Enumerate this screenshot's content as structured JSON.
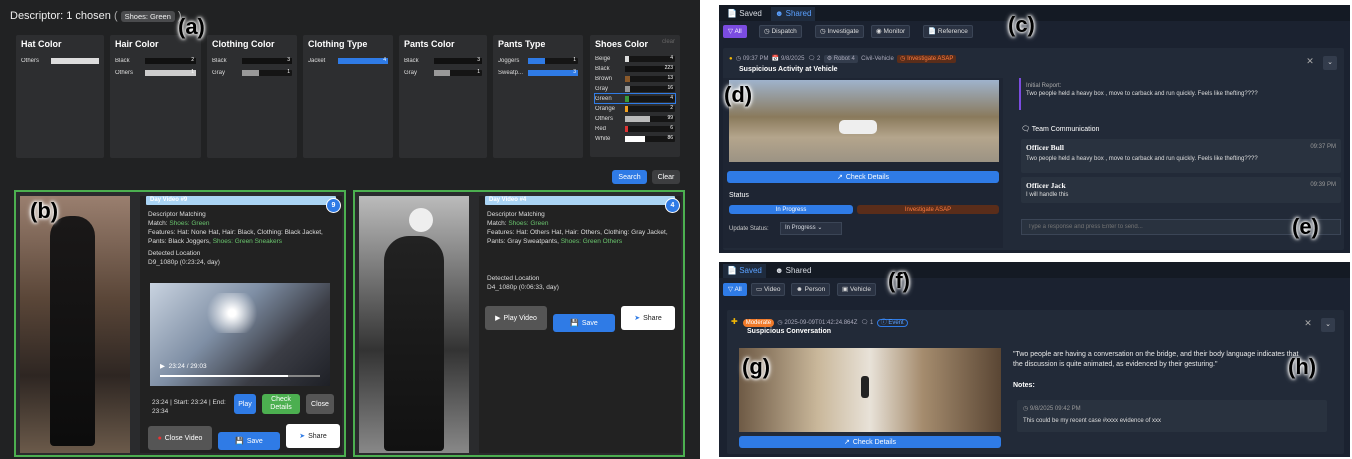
{
  "labels": {
    "a": "(a)",
    "b": "(b)",
    "c": "(c)",
    "d": "(d)",
    "e": "(e)",
    "f": "(f)",
    "g": "(g)",
    "h": "(h)"
  },
  "search": {
    "descriptor": "Descriptor: 1 chosen",
    "chip": "Shoes: Green",
    "search": "Search",
    "clear": "Clear"
  },
  "facets": [
    {
      "title": "Hat Color",
      "rows": [
        {
          "l": "Others",
          "n": "",
          "w": 100,
          "c": "#ddd"
        }
      ]
    },
    {
      "title": "Hair Color",
      "rows": [
        {
          "l": "Black",
          "n": "2",
          "w": 100,
          "c": "#111"
        },
        {
          "l": "Others",
          "n": "1",
          "w": 100,
          "c": "#ccc"
        }
      ]
    },
    {
      "title": "Clothing Color",
      "rows": [
        {
          "l": "Black",
          "n": "3",
          "w": 100,
          "c": "#111"
        },
        {
          "l": "Gray",
          "n": "1",
          "w": 33,
          "c": "#999"
        }
      ]
    },
    {
      "title": "Clothing Type",
      "rows": [
        {
          "l": "Jacket",
          "n": "4",
          "w": 100,
          "c": "#2f7be6"
        }
      ]
    },
    {
      "title": "Pants Color",
      "rows": [
        {
          "l": "Black",
          "n": "3",
          "w": 100,
          "c": "#111"
        },
        {
          "l": "Gray",
          "n": "1",
          "w": 33,
          "c": "#999"
        }
      ]
    },
    {
      "title": "Pants Type",
      "rows": [
        {
          "l": "Joggers",
          "n": "1",
          "w": 33,
          "c": "#2f7be6"
        },
        {
          "l": "Sweatp...",
          "n": "3",
          "w": 100,
          "c": "#2f7be6"
        }
      ]
    }
  ],
  "shoes": {
    "title": "Shoes Color",
    "clear": "clear",
    "rows": [
      {
        "l": "Beige",
        "n": "4",
        "w": 8,
        "c": "#ddd"
      },
      {
        "l": "Black",
        "n": "223",
        "w": 100,
        "c": "#111"
      },
      {
        "l": "Brown",
        "n": "13",
        "w": 10,
        "c": "#8b5a2b"
      },
      {
        "l": "Gray",
        "n": "16",
        "w": 10,
        "c": "#999"
      },
      {
        "l": "Green",
        "n": "4",
        "w": 8,
        "c": "#3a9a3a"
      },
      {
        "l": "Orange",
        "n": "2",
        "w": 6,
        "c": "#f0a020"
      },
      {
        "l": "Others",
        "n": "99",
        "w": 50,
        "c": "#bbb"
      },
      {
        "l": "Red",
        "n": "6",
        "w": 6,
        "c": "#d33"
      },
      {
        "l": "White",
        "n": "86",
        "w": 40,
        "c": "#fff"
      }
    ]
  },
  "card1": {
    "head": "Day Video #9",
    "count": "9",
    "dm": "Descriptor Matching",
    "match_k": "Match:",
    "match_v": "Shoes: Green",
    "feat_k": "Features:",
    "feat_v": "Hat: None Hat, Hair: Black, Clothing: Black Jacket, Pants: Black Joggers,",
    "feat_g": "Shoes: Green Sneakers",
    "loc_k": "Detected Location",
    "loc_v": "D9_1080p (0:23:24, day)",
    "time": "23:24 / 29:03",
    "range": "23:24 | Start: 23:24 | End: 23:34",
    "play": "Play",
    "check": "Check Details",
    "close": "Close",
    "closevid": "Close Video",
    "save": "Save",
    "share": "Share"
  },
  "card2": {
    "head": "Day Video #4",
    "count": "4",
    "dm": "Descriptor Matching",
    "match_k": "Match:",
    "match_v": "Shoes: Green",
    "feat_k": "Features:",
    "feat_v": "Hat: Others Hat, Hair: Others, Clothing: Gray Jacket, Pants: Gray Sweatpants,",
    "feat_g": "Shoes: Green Others",
    "loc_k": "Detected Location",
    "loc_v": "D4_1080p (0:06:33, day)",
    "playvid": "Play Video",
    "save": "Save",
    "share": "Share"
  },
  "top": {
    "tab_saved": "Saved",
    "tab_shared": "Shared",
    "filters": [
      "All",
      "Dispatch",
      "Investigate",
      "Monitor",
      "Reference"
    ],
    "meta_time": "09:37 PM",
    "meta_date": "9/8/2025",
    "meta_comments": "2",
    "meta_robot": "Robot 4",
    "meta_cat": "Civil-Vehicle",
    "meta_tag": "Investigate ASAP",
    "title": "Suspicious Activity at Vehicle",
    "check": "Check Details",
    "status": "Status",
    "s1": "In Progress",
    "s2": "Investigate ASAP",
    "upd": "Update Status:",
    "upd_v": "In Progress",
    "init_k": "Initial Report:",
    "init_v": "Two people held a heavy box , move to carback and run quickly. Feels like thefting????",
    "team": "Team Communication",
    "m1_name": "Officer Bull",
    "m1_time": "09:37 PM",
    "m1_text": "Two people held a heavy box , move to carback and run quickly. Feels like thefting????",
    "m2_name": "Officer Jack",
    "m2_time": "09:39 PM",
    "m2_text": "I will handle this",
    "input_ph": "Type a response and press Enter to send..."
  },
  "bottom": {
    "tab_saved": "Saved",
    "tab_shared": "Shared",
    "filters": [
      "All",
      "Video",
      "Person",
      "Vehicle"
    ],
    "sev": "Moderate",
    "meta": "2025-09-09T01:42:24.864Z",
    "cnt": "1",
    "ev": "Event",
    "title": "Suspicious Conversation",
    "check": "Check Details",
    "quote": "\"Two people are having a conversation on the bridge, and their body language indicates that the discussion is quite animated, as evidenced by their gesturing.\"",
    "notes": "Notes:",
    "note_time": "9/8/2025 09:42 PM",
    "note_text": "This could be my recent case #xxxx evidence of xxx"
  }
}
